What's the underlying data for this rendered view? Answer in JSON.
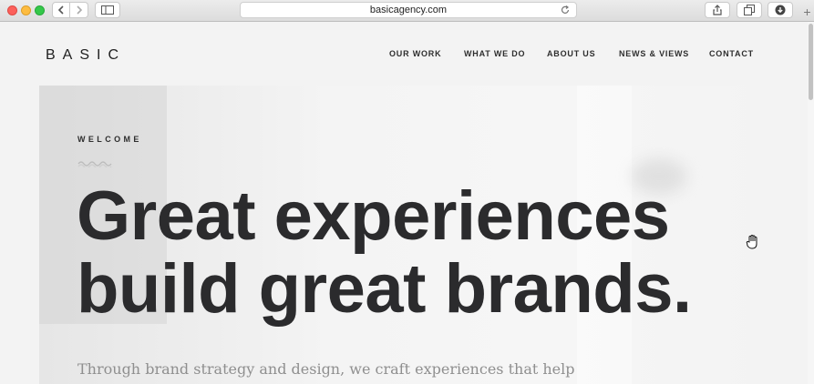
{
  "browser": {
    "url": "basicagency.com",
    "icons": {
      "back": "chevron-left-icon",
      "forward": "chevron-right-icon",
      "sidebar": "sidebar-icon",
      "reload": "reload-icon",
      "share": "share-icon",
      "tabs": "tabs-icon",
      "download": "download-icon",
      "new_tab": "plus-icon"
    },
    "new_tab_glyph": "+"
  },
  "site": {
    "logo": "BASIC",
    "nav": [
      {
        "label": "OUR WORK"
      },
      {
        "label": "WHAT WE DO"
      },
      {
        "label": "ABOUT US"
      },
      {
        "label": "NEWS & VIEWS"
      },
      {
        "label": "CONTACT"
      }
    ]
  },
  "hero": {
    "eyebrow": "WELCOME",
    "headline_line1": "Great experiences",
    "headline_line2": "build great brands.",
    "subtext": "Through brand strategy and design, we craft experiences that help"
  },
  "colors": {
    "text_dark": "#2b2b2d",
    "subtext": "#8f8f8f",
    "background": "#f3f3f3"
  }
}
